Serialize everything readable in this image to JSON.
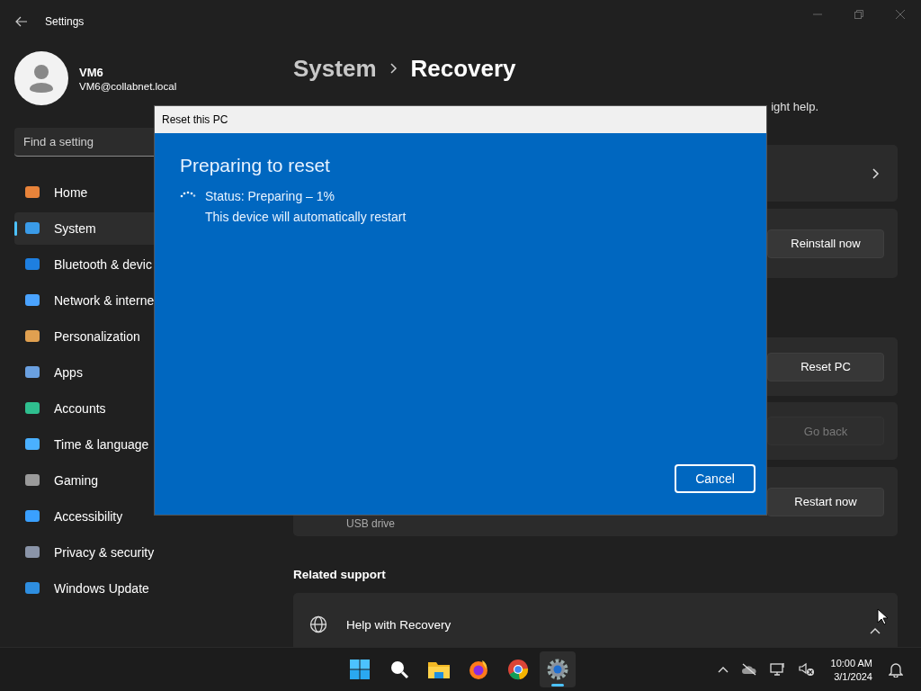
{
  "window": {
    "title": "Settings"
  },
  "user": {
    "name": "VM6",
    "email": "VM6@collabnet.local"
  },
  "search": {
    "placeholder": "Find a setting"
  },
  "nav": [
    {
      "label": "Home",
      "selected": false
    },
    {
      "label": "System",
      "selected": true
    },
    {
      "label": "Bluetooth & devic",
      "selected": false
    },
    {
      "label": "Network & interne",
      "selected": false
    },
    {
      "label": "Personalization",
      "selected": false
    },
    {
      "label": "Apps",
      "selected": false
    },
    {
      "label": "Accounts",
      "selected": false
    },
    {
      "label": "Time & language",
      "selected": false
    },
    {
      "label": "Gaming",
      "selected": false
    },
    {
      "label": "Accessibility",
      "selected": false
    },
    {
      "label": "Privacy & security",
      "selected": false
    },
    {
      "label": "Windows Update",
      "selected": false
    }
  ],
  "breadcrumb": {
    "parent": "System",
    "current": "Recovery"
  },
  "description": "ight help.",
  "cards": [
    {
      "kind": "link"
    },
    {
      "kind": "button",
      "button": "Reinstall now",
      "disabled": false
    },
    {
      "kind": "button",
      "button": "Reset PC",
      "disabled": false
    },
    {
      "kind": "button",
      "button": "Go back",
      "disabled": true
    },
    {
      "kind": "button",
      "button": "Restart now",
      "disabled": false,
      "subtitle": "USB drive"
    }
  ],
  "related": {
    "heading": "Related support",
    "item": "Help with Recovery",
    "expanded": true
  },
  "dialog": {
    "title": "Reset this PC",
    "heading": "Preparing to reset",
    "status": "Status: Preparing – 1%",
    "note": "This device will automatically restart",
    "cancel": "Cancel"
  },
  "taskbar": {
    "apps": [
      {
        "selected": false
      },
      {
        "selected": false
      },
      {
        "selected": false
      },
      {
        "selected": false
      },
      {
        "selected": false
      },
      {
        "selected": true
      }
    ],
    "time": "10:00 AM",
    "date": "3/1/2024"
  }
}
